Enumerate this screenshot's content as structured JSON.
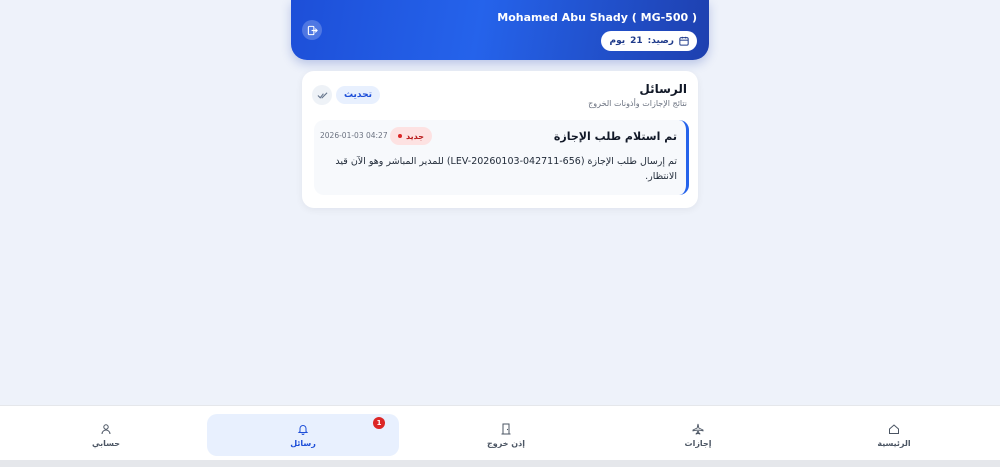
{
  "header": {
    "user_name": "Mohamed Abu Shady ( MG-500 )",
    "balance_label": "رصيد:",
    "balance_value": "21",
    "balance_unit": "يوم",
    "accent_color": "#2563eb"
  },
  "messages_panel": {
    "title": "الرسائل",
    "subtitle": "نتائج الإجازات وأذونات الخروج",
    "refresh_label": "تحديث",
    "mark_read_icon": "double-check-icon",
    "items": [
      {
        "title": "تم استلام طلب الإجازة",
        "badge": "جديد",
        "date": "2026-01-03 04:27",
        "body": "تم إرسال طلب الإجازة (LEV-20260103-042711-656) للمدير المباشر وهو الآن قيد الانتظار."
      }
    ]
  },
  "bottom_nav": {
    "items": [
      {
        "label": "الرئيسية",
        "icon": "home-icon"
      },
      {
        "label": "إجازات",
        "icon": "plane-icon"
      },
      {
        "label": "إذن خروج",
        "icon": "door-icon"
      },
      {
        "label": "رسائل",
        "icon": "bell-icon",
        "active": true,
        "badge": "1"
      },
      {
        "label": "حسابي",
        "icon": "user-icon"
      }
    ]
  }
}
